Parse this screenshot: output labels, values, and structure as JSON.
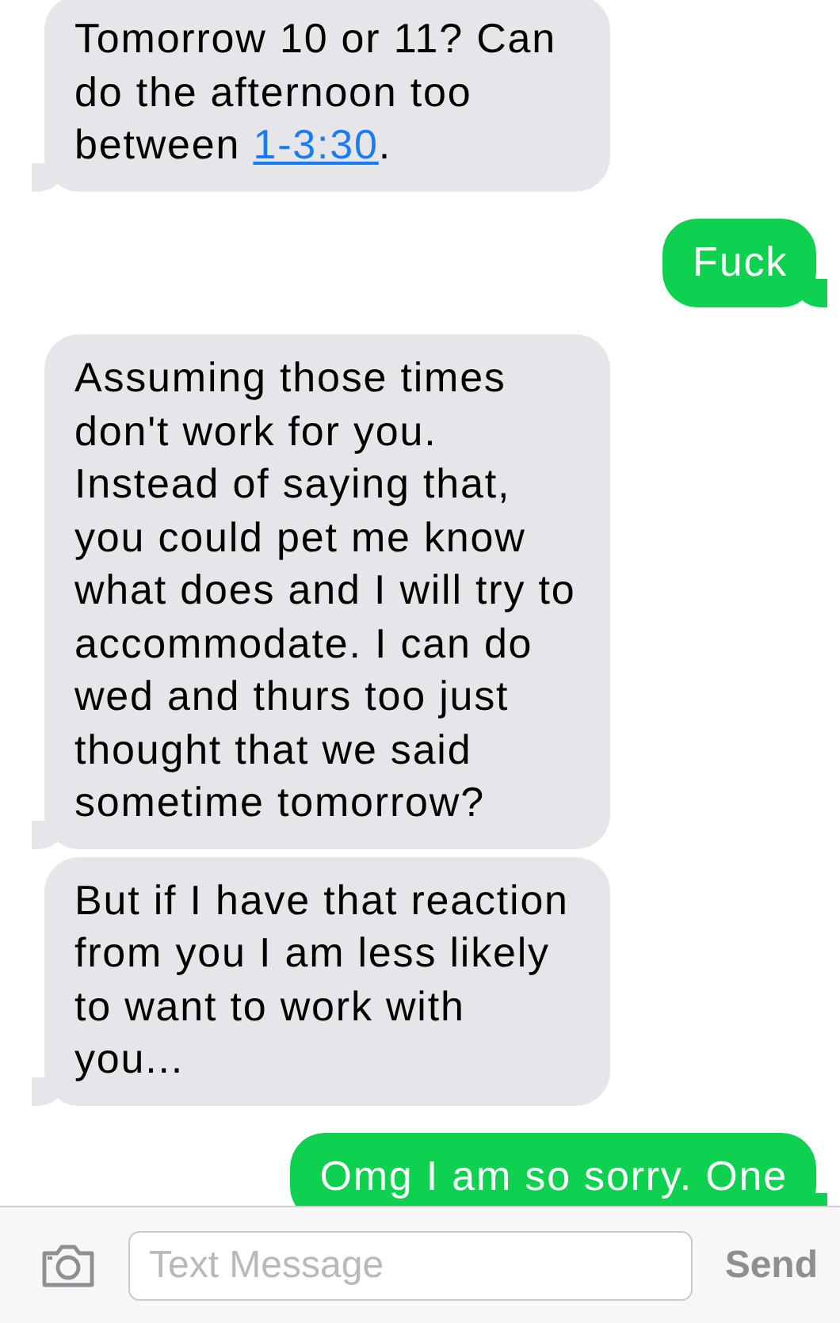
{
  "messages": [
    {
      "kind": "incoming",
      "parts": [
        {
          "kind": "text",
          "text": "Tomorrow 10 or 11? Can do the afternoon too between "
        },
        {
          "kind": "link",
          "text": "1-3:30"
        },
        {
          "kind": "text",
          "text": "."
        }
      ]
    },
    {
      "kind": "outgoing",
      "parts": [
        {
          "kind": "text",
          "text": "Fuck"
        }
      ]
    },
    {
      "kind": "incoming",
      "parts": [
        {
          "kind": "text",
          "text": "Assuming those times don't work for you. Instead of saying that, you could pet me know what does and I will try to accommodate. I can do wed and thurs too just thought that we said sometime tomorrow?"
        }
      ]
    },
    {
      "kind": "incoming",
      "parts": [
        {
          "kind": "text",
          "text": "But if I have that reaction from you I am less likely to want to work with you..."
        }
      ]
    },
    {
      "kind": "outgoing",
      "parts": [
        {
          "kind": "text",
          "text": "Omg I am so sorry. One"
        }
      ]
    }
  ],
  "composer": {
    "placeholder": "Text Message",
    "send": "Send"
  }
}
